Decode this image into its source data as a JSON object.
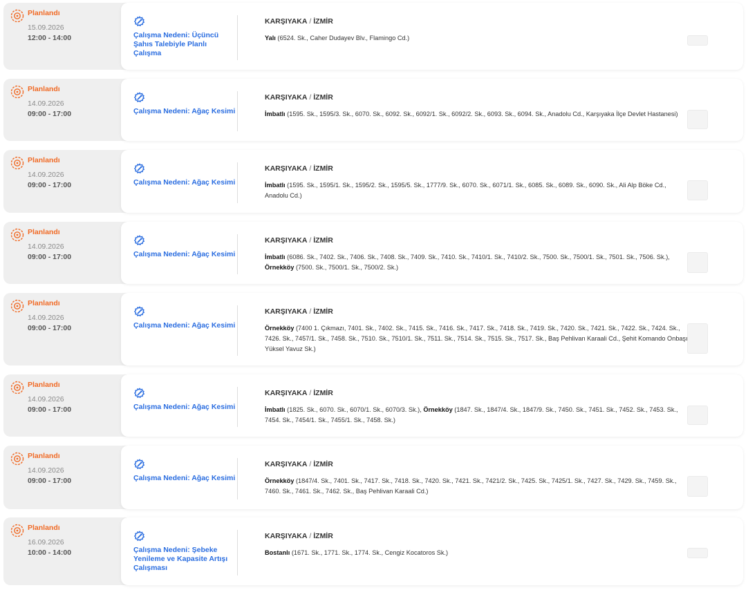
{
  "outages": [
    {
      "status": "Planlandı",
      "date": "15.09.2026",
      "time": "12:00 - 14:00",
      "reason": "Çalışma Nedeni: Üçüncü Şahıs Talebiyle Planlı Çalışma",
      "district": "KARŞIYAKA",
      "city": "İZMİR",
      "areas": [
        {
          "name": "Yalı",
          "streets": "(6524. Sk., Caher Dudayev Blv., Flamingo Cd.)"
        }
      ]
    },
    {
      "status": "Planlandı",
      "date": "14.09.2026",
      "time": "09:00 - 17:00",
      "reason": "Çalışma Nedeni: Ağaç Kesimi",
      "district": "KARŞIYAKA",
      "city": "İZMİR",
      "areas": [
        {
          "name": "İmbatlı",
          "streets": "(1595. Sk., 1595/3. Sk., 6070. Sk., 6092. Sk., 6092/1. Sk., 6092/2. Sk., 6093. Sk., 6094. Sk., Anadolu Cd., Karşıyaka İlçe Devlet Hastanesi)"
        }
      ]
    },
    {
      "status": "Planlandı",
      "date": "14.09.2026",
      "time": "09:00 - 17:00",
      "reason": "Çalışma Nedeni: Ağaç Kesimi",
      "district": "KARŞIYAKA",
      "city": "İZMİR",
      "areas": [
        {
          "name": "İmbatlı",
          "streets": "(1595. Sk., 1595/1. Sk., 1595/2. Sk., 1595/5. Sk., 1777/9. Sk., 6070. Sk., 6071/1. Sk., 6085. Sk., 6089. Sk., 6090. Sk., Ali Alp Böke Cd., Anadolu Cd.)"
        }
      ]
    },
    {
      "status": "Planlandı",
      "date": "14.09.2026",
      "time": "09:00 - 17:00",
      "reason": "Çalışma Nedeni: Ağaç Kesimi",
      "district": "KARŞIYAKA",
      "city": "İZMİR",
      "areas": [
        {
          "name": "İmbatlı",
          "streets": "(6086. Sk., 7402. Sk., 7406. Sk., 7408. Sk., 7409. Sk., 7410. Sk., 7410/1. Sk., 7410/2. Sk., 7500. Sk., 7500/1. Sk., 7501. Sk., 7506. Sk.),"
        },
        {
          "name": "Örnekköy",
          "streets": "(7500. Sk., 7500/1. Sk., 7500/2. Sk.)"
        }
      ]
    },
    {
      "status": "Planlandı",
      "date": "14.09.2026",
      "time": "09:00 - 17:00",
      "reason": "Çalışma Nedeni: Ağaç Kesimi",
      "district": "KARŞIYAKA",
      "city": "İZMİR",
      "areas": [
        {
          "name": "Örnekköy",
          "streets": "(7400 1. Çıkmazı, 7401. Sk., 7402. Sk., 7415. Sk., 7416. Sk., 7417. Sk., 7418. Sk., 7419. Sk., 7420. Sk., 7421. Sk., 7422. Sk., 7424. Sk., 7426. Sk., 7457/1. Sk., 7458. Sk., 7510. Sk., 7510/1. Sk., 7511. Sk., 7514. Sk., 7515. Sk., 7517. Sk., Baş Pehlivan Karaali Cd., Şehit Komando Onbaşı Yüksel Yavuz Sk.)"
        }
      ]
    },
    {
      "status": "Planlandı",
      "date": "14.09.2026",
      "time": "09:00 - 17:00",
      "reason": "Çalışma Nedeni: Ağaç Kesimi",
      "district": "KARŞIYAKA",
      "city": "İZMİR",
      "areas": [
        {
          "name": "İmbatlı",
          "streets": "(1825. Sk., 6070. Sk., 6070/1. Sk., 6070/3. Sk.),"
        },
        {
          "name": "Örnekköy",
          "streets": "(1847. Sk., 1847/4. Sk., 1847/9. Sk., 7450. Sk., 7451. Sk., 7452. Sk., 7453. Sk., 7454. Sk., 7454/1. Sk., 7455/1. Sk., 7458. Sk.)"
        }
      ]
    },
    {
      "status": "Planlandı",
      "date": "14.09.2026",
      "time": "09:00 - 17:00",
      "reason": "Çalışma Nedeni: Ağaç Kesimi",
      "district": "KARŞIYAKA",
      "city": "İZMİR",
      "areas": [
        {
          "name": "Örnekköy",
          "streets": "(1847/4. Sk., 7401. Sk., 7417. Sk., 7418. Sk., 7420. Sk., 7421. Sk., 7421/2. Sk., 7425. Sk., 7425/1. Sk., 7427. Sk., 7429. Sk., 7459. Sk., 7460. Sk., 7461. Sk., 7462. Sk., Baş Pehlivan Karaali Cd.)"
        }
      ]
    },
    {
      "status": "Planlandı",
      "date": "16.09.2026",
      "time": "10:00 - 14:00",
      "reason": "Çalışma Nedeni: Şebeke Yenileme ve Kapasite Artışı Çalışması",
      "district": "KARŞIYAKA",
      "city": "İZMİR",
      "areas": [
        {
          "name": "Bostanlı",
          "streets": "(1671. Sk., 1771. Sk., 1774. Sk., Cengiz Kocatoros Sk.)"
        }
      ]
    }
  ],
  "colors": {
    "status": "#f06a25",
    "reason": "#2a6de0",
    "row_bg": "#efefef"
  },
  "icons": {
    "status": "planned-gear-icon",
    "reason": "wrench-gear-icon"
  }
}
